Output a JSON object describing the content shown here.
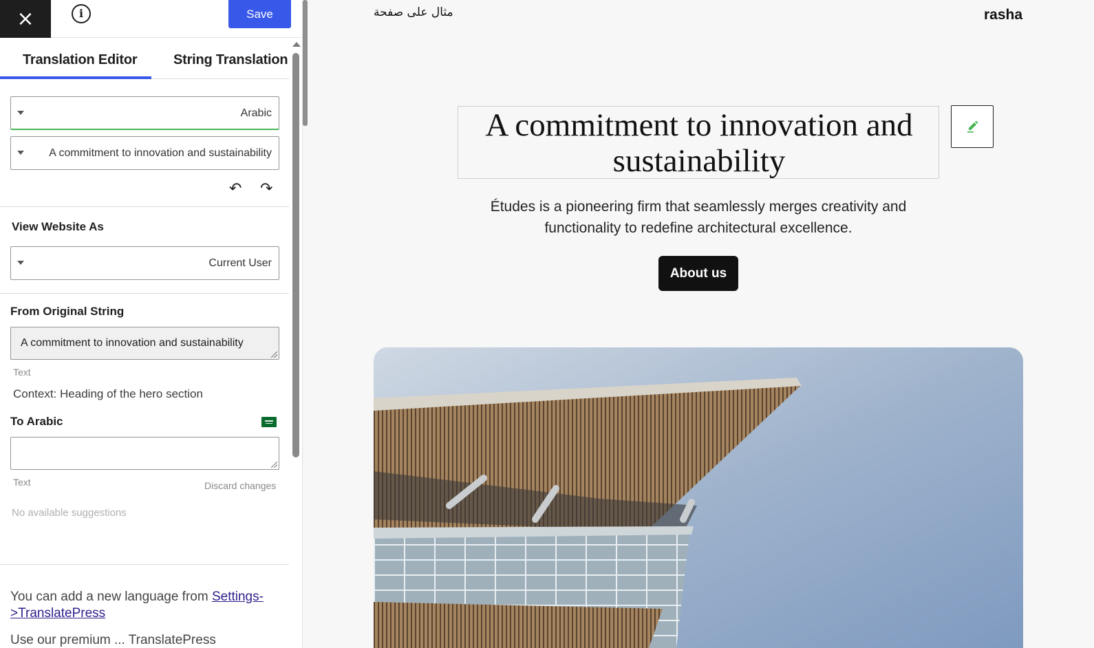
{
  "toolbar": {
    "close_icon": "×",
    "info_icon": "i",
    "save_label": "Save"
  },
  "tabs": [
    {
      "label": "Translation Editor",
      "active": true
    },
    {
      "label": "String Translation",
      "active": false
    }
  ],
  "language_select": {
    "value": "Arabic"
  },
  "string_select": {
    "value": "A commitment to innovation and sustainability"
  },
  "history": {
    "undo_icon": "↶",
    "redo_icon": "↷"
  },
  "view_as": {
    "label": "View Website As",
    "value": "Current User"
  },
  "original": {
    "label": "From Original String",
    "value": "A commitment to innovation and sustainability",
    "type": "Text",
    "context": "Context: Heading of the hero section"
  },
  "translation": {
    "label": "To Arabic",
    "value": "",
    "type": "Text",
    "discard": "Discard changes",
    "suggestions": "No available suggestions"
  },
  "footer": {
    "note_prefix": "You can add a new language from ",
    "note_link": "Settings->TranslatePress",
    "note2": "Use our premium ... TranslatePress"
  },
  "site": {
    "title": "مثال على صفحة",
    "user": "rasha",
    "heading": "A commitment to innovation and sustainability",
    "description": "Études is a pioneering firm that seamlessly merges creativity and functionality to redefine architectural excellence.",
    "button": "About us"
  },
  "colors": {
    "accent": "#3858e9",
    "success": "#46b450",
    "dark": "#1e1e1e"
  }
}
